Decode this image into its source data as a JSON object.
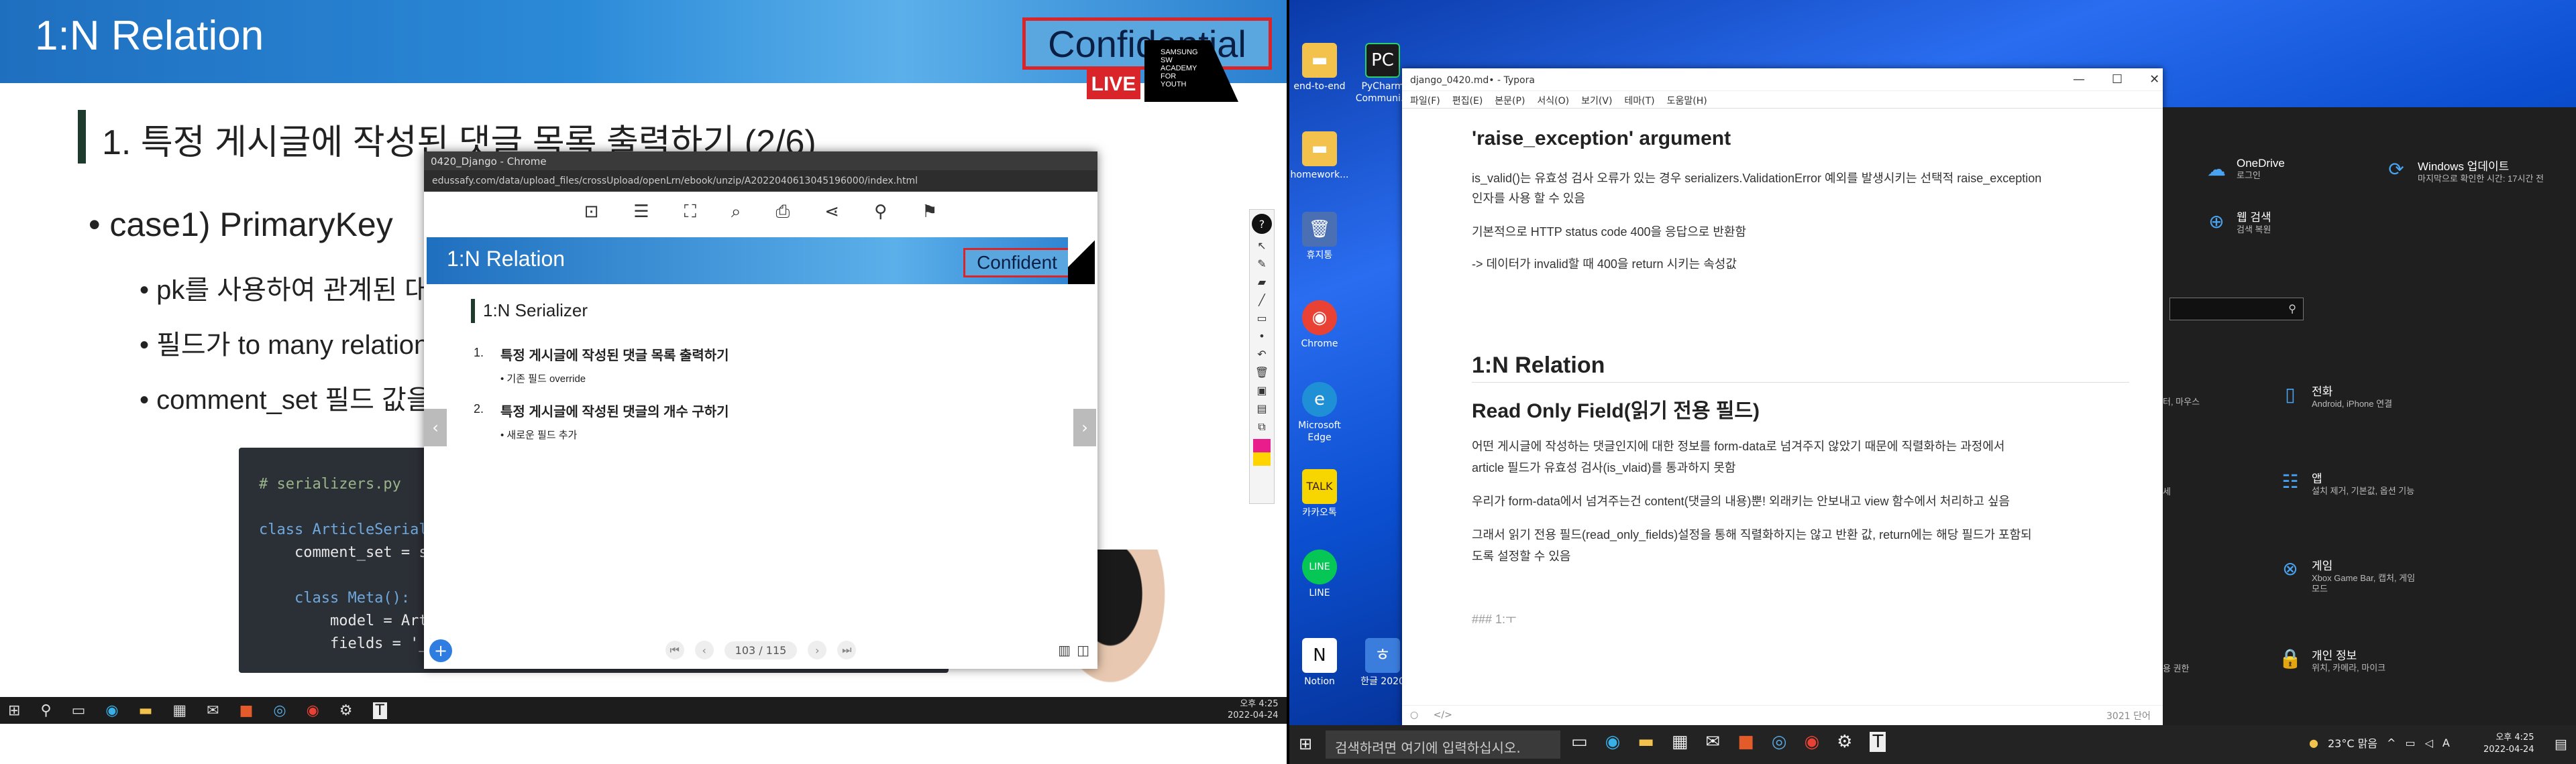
{
  "left": {
    "slide_title": "1:N Relation",
    "confidential": "Confidential",
    "live": "LIVE",
    "logo_text": "SAMSUNG SW ACADEMY FOR YOUTH",
    "heading": "1. 특정 게시글에 작성된 댓글 목록 출력하기 (2/6)",
    "bullets": [
      "• case1) PrimaryKey",
      "• pk를 사용하여 관계된 대",
      "• 필드가 to many relation",
      "• comment_set 필드 값을"
    ],
    "code_lines": [
      "# serializers.py",
      "",
      "class ArticleSeriali",
      "    comment_set = se",
      "",
      "    class Meta():",
      "        model = Arti",
      "        fields = '_"
    ],
    "popup": {
      "window_title": "0420_Django - Chrome",
      "url": "edussafy.com/data/upload_files/crossUpload/openLrn/ebook/unzip/A2022040613045196000/index.html",
      "page_title": "1:N Relation",
      "page_conf": "Confident",
      "page_heading": "1:N Serializer",
      "items": [
        {
          "num": "1.",
          "text": "특정 게시글에 작성된 댓글 목록 출력하기",
          "sub": "• 기존 필드 override"
        },
        {
          "num": "2.",
          "text": "특정 게시글에 작성된 댓글의 개수 구하기",
          "sub": "• 새로운 필드 추가"
        }
      ],
      "page_indicator": "103 / 115",
      "toolbar_icons": [
        "bookmark-icon",
        "list-icon",
        "fullscreen-icon",
        "zoom-icon",
        "print-icon",
        "share-icon",
        "search-icon",
        "bookmark-flag-icon"
      ]
    },
    "clock": {
      "time": "오후 4:25",
      "date": "2022-04-24"
    }
  },
  "right": {
    "desktop_icons": [
      {
        "label": "end-to-end",
        "color": "#f3c24d"
      },
      {
        "label": "PyCharm Communi...",
        "color": "#1b1b1b"
      },
      {
        "label": "homework...",
        "color": "#f3c24d"
      },
      {
        "label": "휴지통",
        "color": "#4a6fb3"
      },
      {
        "label": "Chrome",
        "color": "#e94235"
      },
      {
        "label": "Microsoft Edge",
        "color": "#1f8fd6"
      },
      {
        "label": "카카오톡",
        "color": "#f7d600"
      },
      {
        "label": "LINE",
        "color": "#06c755"
      },
      {
        "label": "Notion",
        "color": "#ffffff"
      },
      {
        "label": "한글 2020",
        "color": "#3b7ddd"
      }
    ],
    "typora": {
      "title": "django_0420.md• - Typora",
      "menu": [
        "파일(F)",
        "편집(E)",
        "본문(P)",
        "서식(O)",
        "보기(V)",
        "테마(T)",
        "도움말(H)"
      ],
      "h_raise": "'raise_exception' argument",
      "p1a": "is_valid()는 유효성 검사 오류가 있는 경우 serializers.ValidationError 예외를 발생시키는 선택적 raise_exception",
      "p1b": "인자를 사용 할 수 있음",
      "p2": "기본적으로 HTTP status code 400을 응답으로 반환함",
      "p3": "-> 데이터가 invalid할 때 400을 return 시키는 속성값",
      "h_relation": "1:N Relation",
      "h_readonly": "Read Only Field(읽기 전용 필드)",
      "p4a": "어떤 게시글에 작성하는 댓글인지에 대한 정보를 form-data로 넘겨주지 않았기 때문에 직렬화하는 과정에서",
      "p4b": "article 필드가 유효성 검사(is_vlaid)를 통과하지 못함",
      "p5": "우리가 form-data에서 넘겨주는건 content(댓글의 내용)뿐! 외래키는 안보내고 view 함수에서 처리하고 싶음",
      "p6a": "그래서 읽기 전용 필드(read_only_fields)설정을 통해 직렬화하지는 않고 반환 값, return에는 해당 필드가 포함되",
      "p6b": "도록 설정할 수 있음",
      "draft": "### 1:ㅜ",
      "word_count": "3021 단어"
    },
    "settings": [
      {
        "title": "OneDrive",
        "sub": "로그인",
        "icon": "onedrive-icon"
      },
      {
        "title": "Windows 업데이트",
        "sub": "마지막으로 확인한 시간: 17시간 전",
        "icon": "update-icon"
      },
      {
        "title": "웹 검색",
        "sub": "검색 복원",
        "icon": "web-search-icon"
      },
      {
        "title": "전화",
        "sub": "Android, iPhone 연결",
        "icon": "phone-icon"
      },
      {
        "title": "앱",
        "sub": "설치 제거, 기본값, 옵션 기능",
        "icon": "apps-icon"
      },
      {
        "title": "게임",
        "sub": "Xbox Game Bar, 캡처, 게임 모드",
        "icon": "xbox-icon"
      },
      {
        "title": "개인 정보",
        "sub": "위치, 카메라, 마이크",
        "icon": "lock-icon"
      }
    ],
    "settings_partial": [
      "터, 마우스",
      "세",
      "용 권한"
    ],
    "taskbar": {
      "search_placeholder": "검색하려면 여기에 입력하십시오.",
      "weather": "23°C 맑음",
      "ime": "A",
      "time": "오후 4:25",
      "date": "2022-04-24"
    }
  }
}
